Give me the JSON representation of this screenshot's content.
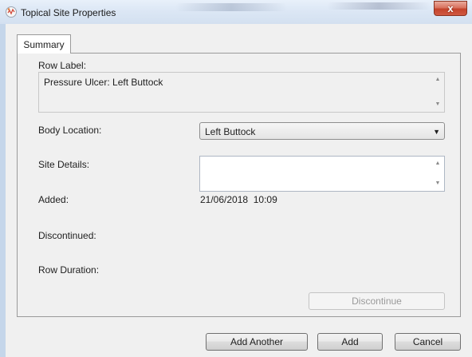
{
  "window": {
    "title": "Topical Site Properties",
    "close_glyph": "x",
    "app_icon": "patient-chart-icon"
  },
  "tabs": [
    {
      "label": "Summary",
      "selected": true
    }
  ],
  "form": {
    "row_label": {
      "label": "Row Label:",
      "value": "Pressure Ulcer: Left Buttock"
    },
    "body_location": {
      "label": "Body Location:",
      "value": "Left Buttock"
    },
    "site_details": {
      "label": "Site Details:",
      "value": ""
    },
    "added": {
      "label": "Added:",
      "value": "21/06/2018  10:09"
    },
    "discontinued": {
      "label": "Discontinued:"
    },
    "row_duration": {
      "label": "Row Duration:"
    }
  },
  "buttons": {
    "discontinue": "Discontinue",
    "add_another": "Add Another",
    "add": "Add",
    "cancel": "Cancel"
  },
  "colors": {
    "close_button": "#c4432b",
    "titlebar": "#dce7f5",
    "dialog_background": "#f0f0f0"
  }
}
